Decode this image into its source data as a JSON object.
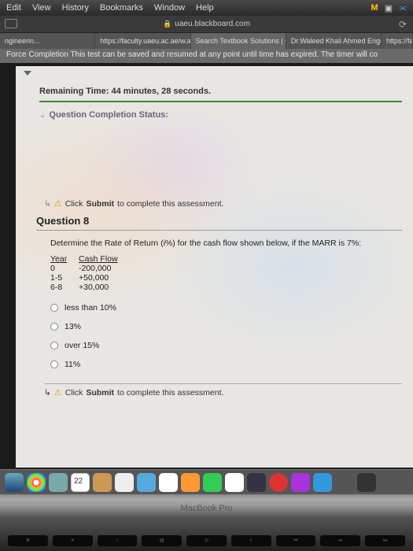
{
  "menubar": {
    "items": [
      "Edit",
      "View",
      "History",
      "Bookmarks",
      "Window",
      "Help"
    ]
  },
  "url": "uaeu.blackboard.com",
  "tabs": [
    {
      "label": "ngineerin..."
    },
    {
      "label": "https://faculty.uaeu.ac.ae/w.ahm..."
    },
    {
      "label": "Search Textbook Solutions | Che..."
    },
    {
      "label": "Dr.Waleed Khali Ahmed Engineeri..."
    },
    {
      "label": "https://fa"
    }
  ],
  "force_completion": "Force Completion  This test can be saved and resumed at any point until time has expired. The timer will co",
  "timer": {
    "label": "Remaining Time:",
    "value": "44 minutes, 28 seconds."
  },
  "status_label": "Question Completion Status:",
  "submit_hint_prefix": "Click ",
  "submit_hint_bold": "Submit",
  "submit_hint_suffix": " to complete this assessment.",
  "question": {
    "title": "Question 8",
    "prompt": "Determine the Rate of Return (i%) for the cash flow shown below, if the MARR is 7%:",
    "table_headers": {
      "c1": "Year",
      "c2": "Cash Flow"
    },
    "rows": [
      {
        "c1": "0",
        "c2": "-200,000"
      },
      {
        "c1": "1-5",
        "c2": "+50,000"
      },
      {
        "c1": "6-8",
        "c2": "+30,000"
      }
    ],
    "options": [
      "less than 10%",
      "13%",
      "over 15%",
      "11%"
    ]
  },
  "laptop_label": "MacBook Pro",
  "fnkeys": [
    "✻",
    "☀",
    "☼",
    "▤",
    "◎",
    "◐",
    "⏮",
    "⏯",
    "⏭"
  ]
}
